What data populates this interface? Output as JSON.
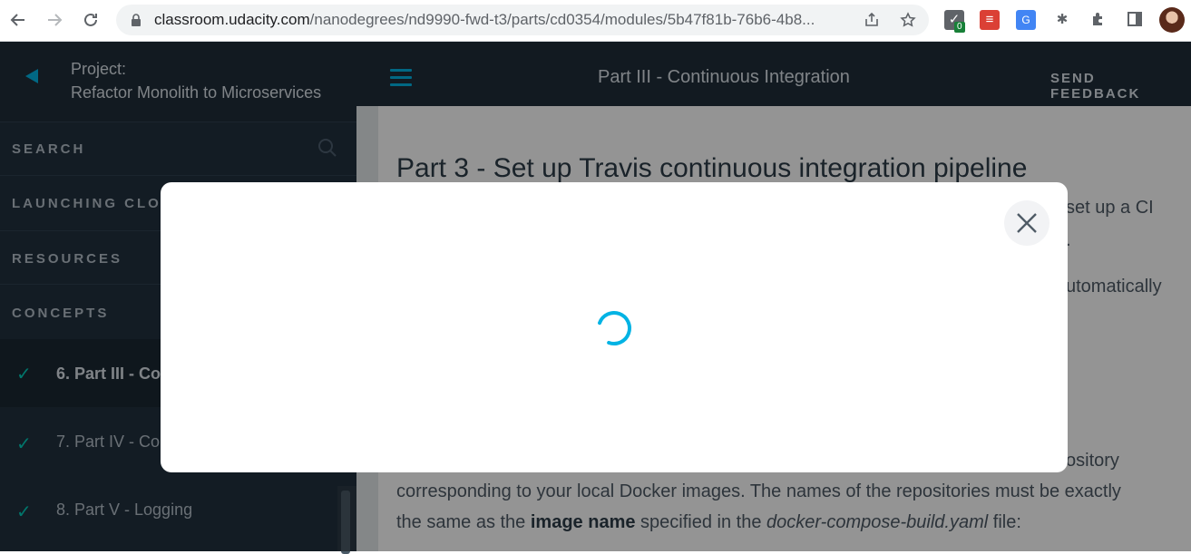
{
  "browser": {
    "url_host": "classroom.udacity.com",
    "url_path": "/nanodegrees/nd9990-fwd-t3/parts/cd0354/modules/5b47f81b-76b6-4b8...",
    "extension_badge": "0",
    "icons": [
      "back-arrow-icon",
      "forward-arrow-icon",
      "reload-icon",
      "lock-icon",
      "share-icon",
      "star-icon",
      "extension-check-icon",
      "todoist-icon",
      "translate-icon",
      "bug-icon",
      "puzzle-icon",
      "side-panel-icon",
      "avatar"
    ]
  },
  "sidebar": {
    "project_label": "Project:",
    "project_name": "Refactor Monolith to Microservices",
    "search_label": "SEARCH",
    "sections": [
      "LAUNCHING CLOU",
      "RESOURCES",
      "CONCEPTS"
    ],
    "concepts": [
      {
        "label": "6. Part III - Co",
        "completed": true,
        "active": true
      },
      {
        "label": "7. Part IV - Co",
        "completed": true,
        "active": false
      },
      {
        "label": "8. Part V - Logging",
        "completed": true,
        "active": false
      }
    ],
    "check_glyph": "✓"
  },
  "topbar": {
    "title": "Part III - Continuous Integration",
    "feedback": "SEND FEEDBACK"
  },
  "content": {
    "heading": "Part 3 - Set up Travis continuous integration pipeline",
    "frag1": "set up a CI",
    "frag2": ".",
    "frag3": "utomatically",
    "frag4": "ository",
    "line1": "corresponding to your local Docker images. The names of the repositories must be exactly",
    "line2_pre": "the same as the ",
    "line2_bold": "image name",
    "line2_mid": " specified in the ",
    "line2_ital": "docker-compose-build.yaml",
    "line2_post": " file:"
  },
  "modal": {
    "state": "loading"
  },
  "colors": {
    "accent": "#02b3e4",
    "check": "#02ccba",
    "sidebar_bg": "#22313e",
    "topbar_bg": "#1f2e3a"
  }
}
